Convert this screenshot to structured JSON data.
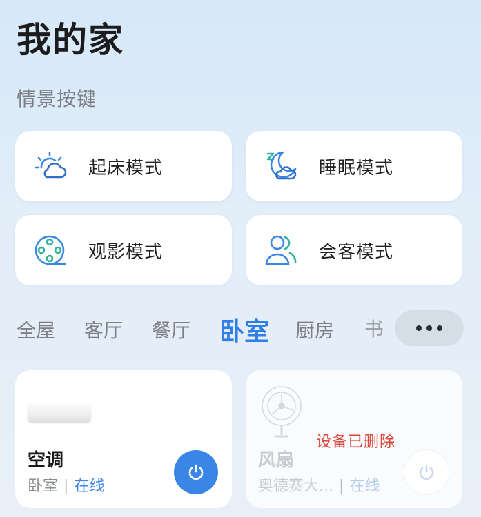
{
  "page": {
    "title": "我的家"
  },
  "scenes": {
    "section_label": "情景按键",
    "items": [
      {
        "label": "起床模式",
        "icon": "sun-cloud-icon"
      },
      {
        "label": "睡眠模式",
        "icon": "moon-sleep-icon"
      },
      {
        "label": "观影模式",
        "icon": "film-reel-icon"
      },
      {
        "label": "会客模式",
        "icon": "users-icon"
      }
    ]
  },
  "rooms": {
    "tabs": [
      "全屋",
      "客厅",
      "餐厅",
      "卧室",
      "厨房",
      "书"
    ],
    "active": "卧室",
    "more_icon": "more-dots-icon"
  },
  "devices": [
    {
      "name": "空调",
      "room": "卧室",
      "status": "在线",
      "icon": "power-icon"
    },
    {
      "name": "风扇",
      "room": "奥德赛大...",
      "status": "在线",
      "notice": "设备已删除",
      "icon": "power-icon"
    }
  ],
  "colors": {
    "accent": "#3a86e6",
    "deleted": "#d9463a"
  }
}
